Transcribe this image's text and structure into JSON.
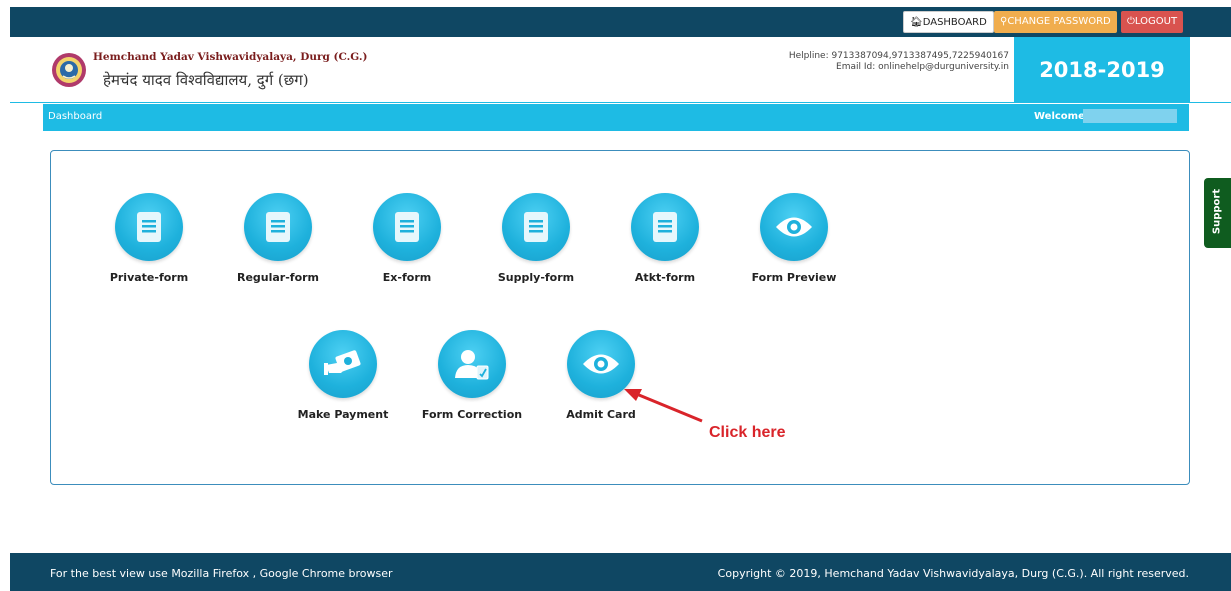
{
  "topbar": {
    "dashboard_label": "DASHBOARD",
    "change_password_label": "CHANGE PASSWORD",
    "logout_label": "LOGOUT"
  },
  "header": {
    "brand_en": "Hemchand Yadav Vishwavidyalaya, Durg (C.G.)",
    "brand_hi": "हेमचंद यादव विश्वविद्यालय, दुर्ग (छग)",
    "helpline": "Helpline: 9713387094,9713387495,7225940167",
    "email": "Email Id: onlinehelp@durguniversity.in",
    "session": "2018-2019"
  },
  "breadcrumb": {
    "label": "Dashboard",
    "welcome": "Welcome"
  },
  "tiles_row1": [
    {
      "label": "Private-form",
      "icon": "document-icon"
    },
    {
      "label": "Regular-form",
      "icon": "document-icon"
    },
    {
      "label": "Ex-form",
      "icon": "document-icon"
    },
    {
      "label": "Supply-form",
      "icon": "document-icon"
    },
    {
      "label": "Atkt-form",
      "icon": "document-icon"
    },
    {
      "label": "Form Preview",
      "icon": "eye-icon"
    }
  ],
  "tiles_row2": [
    {
      "label": "Make Payment",
      "icon": "payment-icon"
    },
    {
      "label": "Form Correction",
      "icon": "user-edit-icon"
    },
    {
      "label": "Admit Card",
      "icon": "eye-icon"
    }
  ],
  "annotation": {
    "text": "Click here",
    "color": "#d9242a"
  },
  "support": {
    "label": "Support"
  },
  "footer": {
    "left": "For the best view use Mozilla Firefox , Google Chrome browser",
    "right": "Copyright © 2019, Hemchand Yadav Vishwavidyalaya, Durg (C.G.). All right reserved."
  },
  "colors": {
    "topbar": "#0f4763",
    "accent": "#1ebbe4",
    "warning": "#f0ad4e",
    "danger": "#d9534f",
    "support": "#0f5c1f"
  }
}
